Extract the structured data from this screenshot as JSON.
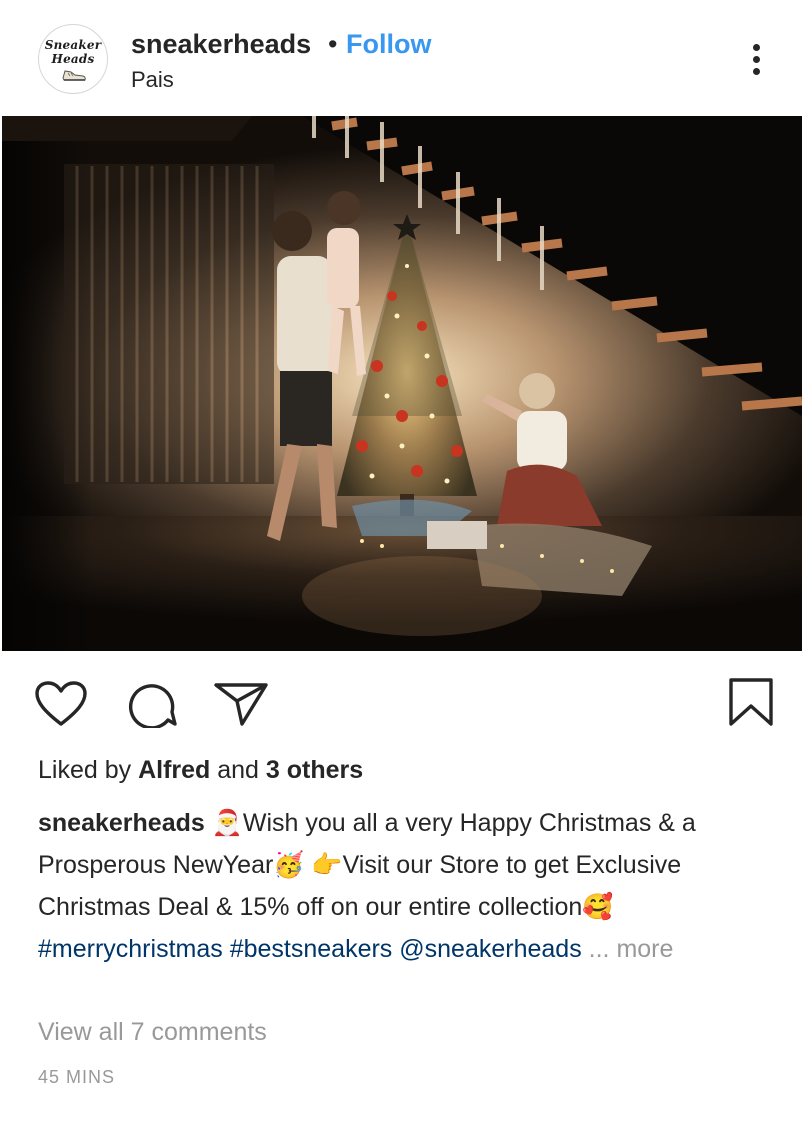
{
  "header": {
    "avatar_line1": "Sneaker",
    "avatar_line2": "Heads",
    "username": "sneakerheads",
    "separator": "•",
    "follow_label": "Follow",
    "location": "Pais"
  },
  "icons": {
    "more": "more-options-icon",
    "like": "heart-icon",
    "comment": "comment-icon",
    "share": "paper-plane-icon",
    "save": "bookmark-icon"
  },
  "likes": {
    "prefix": "Liked by ",
    "user": "Alfred",
    "middle": " and ",
    "others": "3 others"
  },
  "caption": {
    "username": "sneakerheads",
    "emoji_santa": "🎅",
    "text_1": "Wish you all a very Happy Christmas & a Prosperous NewYear",
    "emoji_party": "🥳",
    "emoji_point": "👉",
    "text_2": "Visit our Store to get Exclusive Christmas Deal & 15% off on our entire collection",
    "emoji_love": "🥰",
    "hashtag_1": "#merrychristmas",
    "hashtag_2": "#bestsneakers",
    "mention": "@sneakerheads",
    "more_label": "... more"
  },
  "comments": {
    "view_all": "View all 7 comments"
  },
  "timestamp": "45 MINS",
  "colors": {
    "link_blue": "#3897f0",
    "hashtag_blue": "#003569",
    "muted_gray": "#999999",
    "text": "#262626"
  }
}
